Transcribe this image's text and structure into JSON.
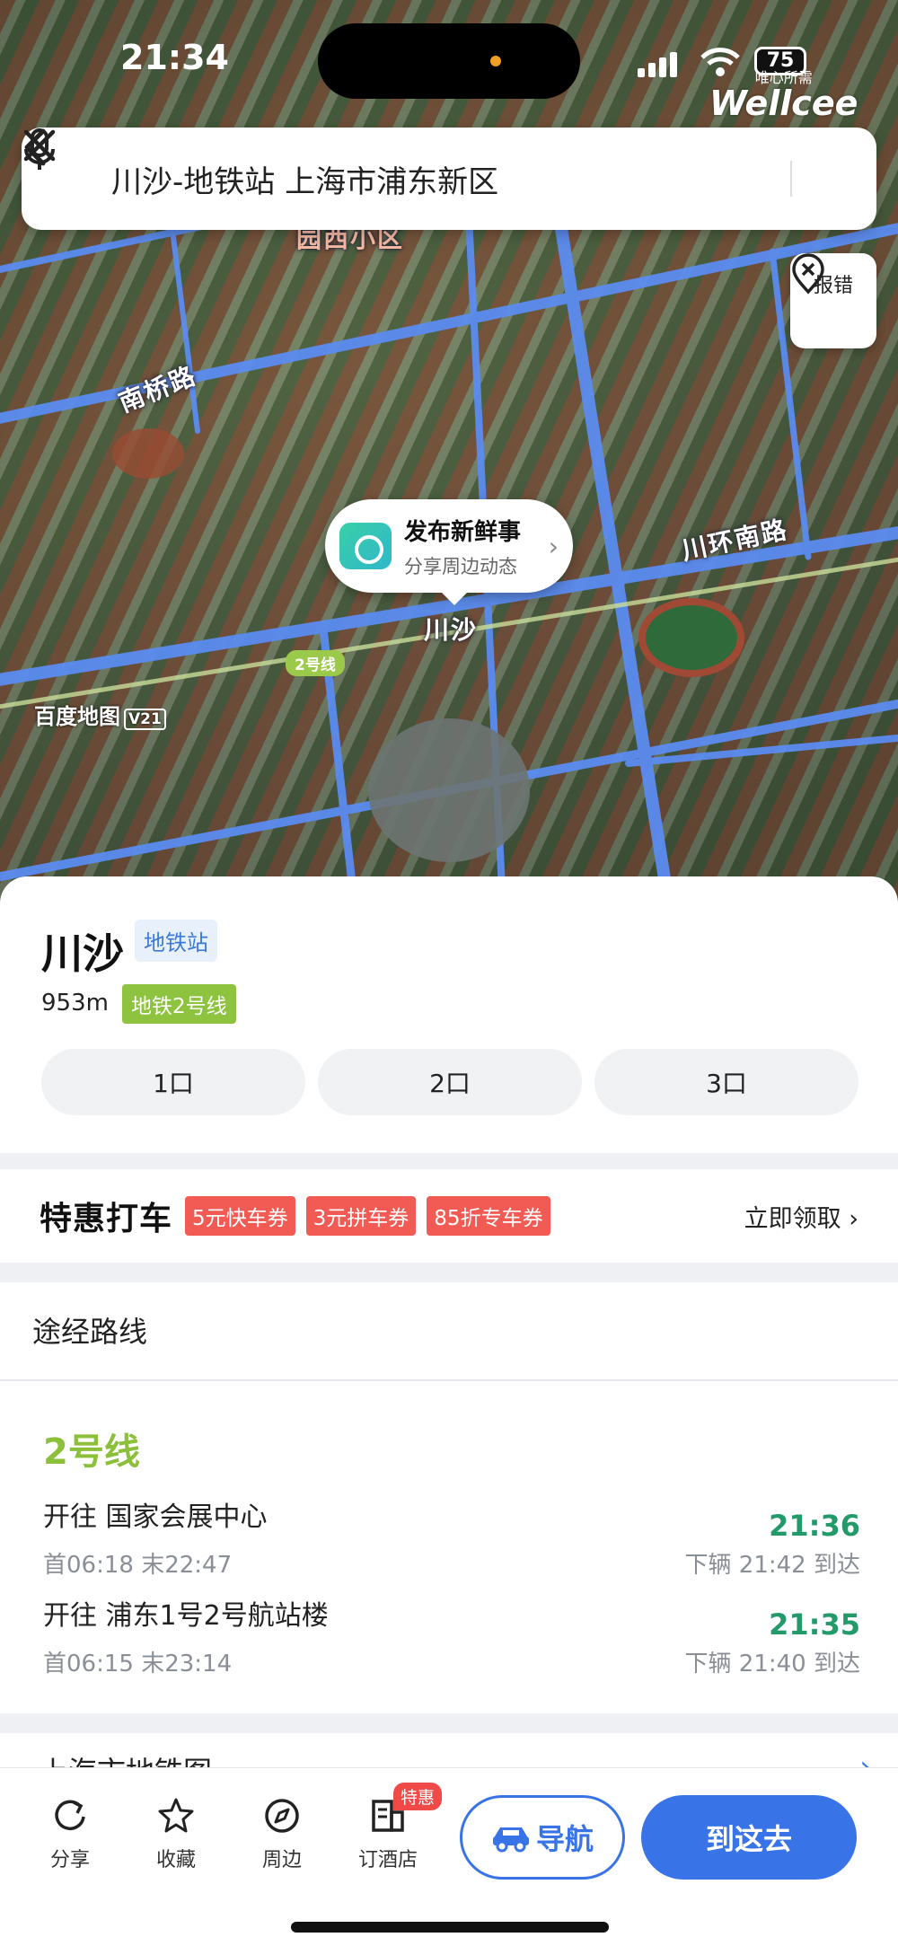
{
  "status_bar": {
    "time": "21:34",
    "battery": "75"
  },
  "watermark": {
    "line1": "唯心所需",
    "line2": "Wellcee"
  },
  "search": {
    "query": "川沙-地铁站 上海市浦东新区"
  },
  "map": {
    "report_label": "报错",
    "road_labels": [
      "南桥路",
      "川环南路",
      "园西小区"
    ],
    "line_badge": "2号线",
    "station_label": "川沙",
    "logo": "百度地图",
    "logo_version": "V21",
    "bubble": {
      "title": "发布新鲜事",
      "subtitle": "分享周边动态"
    }
  },
  "poi": {
    "name": "川沙",
    "category": "地铁站",
    "distance": "953m",
    "line": "地铁2号线",
    "exits": [
      "1口",
      "2口",
      "3口"
    ]
  },
  "taxi": {
    "title": "特惠打车",
    "coupons": [
      "5元快车券",
      "3元拼车券",
      "85折专车券"
    ],
    "action": "立即领取"
  },
  "routes": {
    "heading": "途经路线",
    "line_name": "2号线",
    "items": [
      {
        "direction": "开往 国家会展中心",
        "first_last": "首06:18 末22:47",
        "next": "21:36",
        "after": "下辆 21:42 到达"
      },
      {
        "direction": "开往 浦东1号2号航站楼",
        "first_last": "首06:15 末23:14",
        "after": "下辆 21:40 到达",
        "next": "21:35"
      }
    ]
  },
  "metro_map": {
    "label": "上海市地铁图"
  },
  "bottom_bar": {
    "tools": [
      "分享",
      "收藏",
      "周边",
      "订酒店"
    ],
    "hotel_badge": "特惠",
    "navigate": "导航",
    "go_here": "到这去"
  },
  "colors": {
    "accent": "#3874e8",
    "line2_green": "#8cbf3a",
    "coupon_red": "#f25b54",
    "arrival_green": "#239a6a"
  }
}
